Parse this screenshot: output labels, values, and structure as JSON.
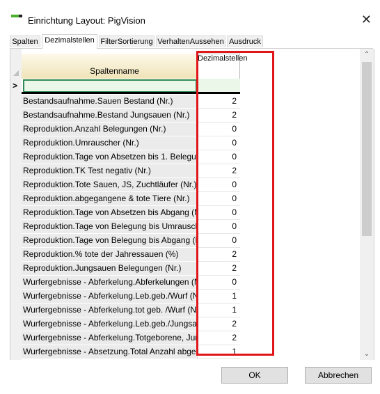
{
  "window": {
    "title": "Einrichtung Layout: PigVision",
    "close_glyph": "✕"
  },
  "tabs": [
    {
      "label": "Spalten",
      "active": false
    },
    {
      "label": "Dezimalstellen",
      "active": true
    },
    {
      "label": "FilterSortierung",
      "active": false
    },
    {
      "label": "VerhaltenAussehen",
      "active": false
    },
    {
      "label": "Ausdruck",
      "active": false
    }
  ],
  "grid": {
    "columns": {
      "name": "Spaltenname",
      "decimals": "Dezimalstellen"
    },
    "filter_marker": ">",
    "rows": [
      {
        "name": "Bestandsaufnahme.Sauen Bestand (Nr.)",
        "value": "2"
      },
      {
        "name": "Bestandsaufnahme.Bestand Jungsauen (Nr.)",
        "value": "2"
      },
      {
        "name": "Reproduktion.Anzahl Belegungen (Nr.)",
        "value": "0"
      },
      {
        "name": "Reproduktion.Umrauscher (Nr.)",
        "value": "0"
      },
      {
        "name": "Reproduktion.Tage von Absetzen bis 1. Belegung (",
        "value": "0"
      },
      {
        "name": "Reproduktion.TK Test negativ (Nr.)",
        "value": "2"
      },
      {
        "name": "Reproduktion.Tote Sauen, JS, Zuchtläufer (Nr.)",
        "value": "0"
      },
      {
        "name": "Reproduktion.abgegangene & tote Tiere (Nr.)",
        "value": "0"
      },
      {
        "name": "Reproduktion.Tage von Absetzen bis Abgang (Nr.)",
        "value": "0"
      },
      {
        "name": "Reproduktion.Tage von Belegung bis Umrauschen",
        "value": "0"
      },
      {
        "name": "Reproduktion.Tage von Belegung bis Abgang (Nr.)",
        "value": "0"
      },
      {
        "name": "Reproduktion.% tote der Jahressauen (%)",
        "value": "2"
      },
      {
        "name": "Reproduktion.Jungsauen Belegungen (Nr.)",
        "value": "2"
      },
      {
        "name": "Wurfergebnisse - Abferkelung.Abferkelungen (Nr.)",
        "value": "0"
      },
      {
        "name": "Wurfergebnisse - Abferkelung.Leb.geb./Wurf (Nr.)",
        "value": "1"
      },
      {
        "name": "Wurfergebnisse - Abferkelung.tot geb. /Wurf (Nr.)",
        "value": "1"
      },
      {
        "name": "Wurfergebnisse - Abferkelung.Leb.geb./Jungsauer",
        "value": "2"
      },
      {
        "name": "Wurfergebnisse - Abferkelung.Totgeborene, Jungs",
        "value": "2"
      },
      {
        "name": "Wurfergebnisse - Absetzung.Total Anzahl abgesetz",
        "value": "1"
      }
    ]
  },
  "scrollbar": {
    "up_glyph": "⌃",
    "down_glyph": "⌄"
  },
  "buttons": {
    "ok": "OK",
    "cancel": "Abbrechen"
  },
  "colors": {
    "highlight": "#e0161b",
    "filter_row": "#eaf7e9",
    "header": "#f3ecd2"
  }
}
